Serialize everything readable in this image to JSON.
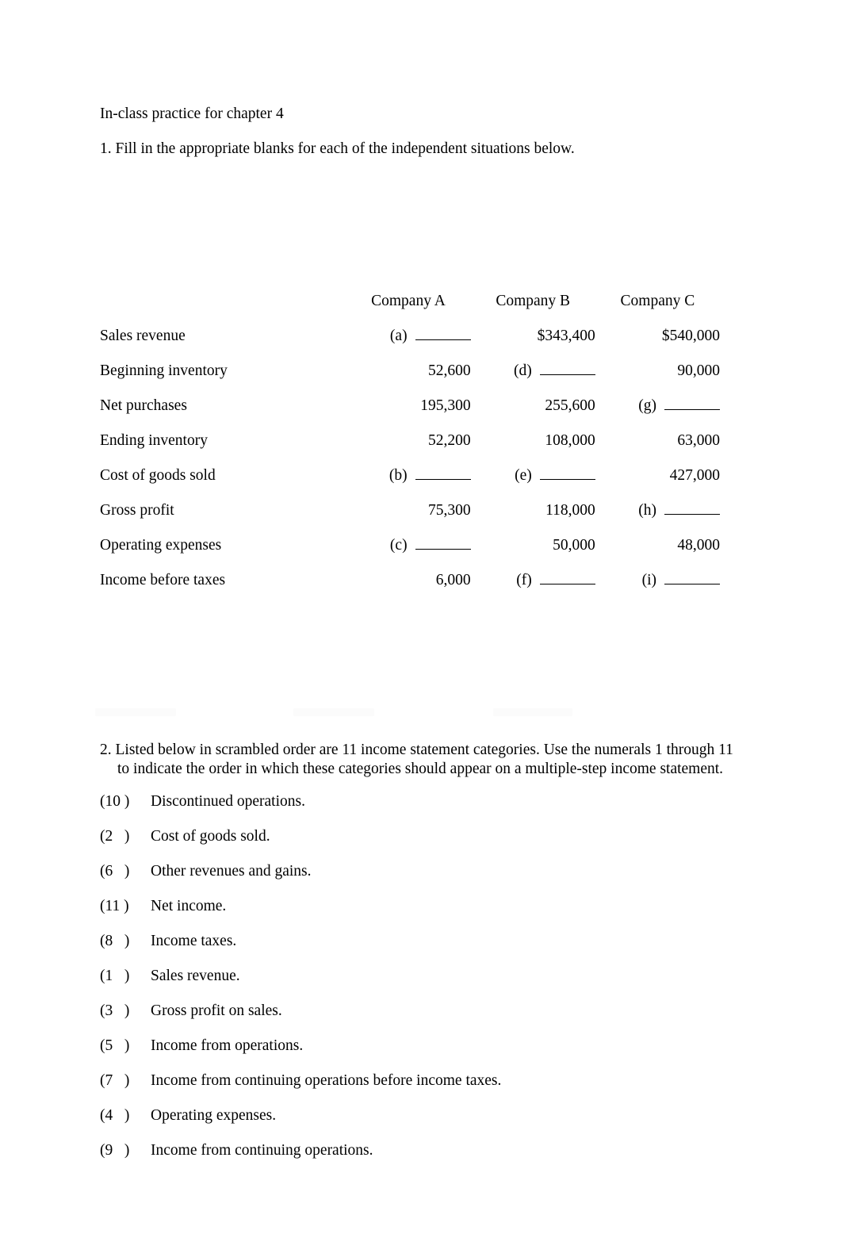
{
  "document": {
    "title": "In-class practice for chapter 4",
    "question1": "1. Fill in the appropriate blanks for each of the independent situations below."
  },
  "table": {
    "row_header_blank": "",
    "columns": [
      "Company A",
      "Company B",
      "Company C"
    ],
    "rows": [
      {
        "label": "Sales revenue",
        "cells": [
          {
            "type": "blank",
            "tag": "(a)",
            "value": ""
          },
          {
            "type": "value",
            "tag": "",
            "value": "$343,400"
          },
          {
            "type": "value",
            "tag": "",
            "value": "$540,000"
          }
        ]
      },
      {
        "label": "Beginning inventory",
        "cells": [
          {
            "type": "value",
            "tag": "",
            "value": "52,600"
          },
          {
            "type": "blank",
            "tag": "(d)",
            "value": ""
          },
          {
            "type": "value",
            "tag": "",
            "value": "90,000"
          }
        ]
      },
      {
        "label": "Net purchases",
        "cells": [
          {
            "type": "value",
            "tag": "",
            "value": "195,300"
          },
          {
            "type": "value",
            "tag": "",
            "value": "255,600"
          },
          {
            "type": "blank",
            "tag": "(g)",
            "value": ""
          }
        ]
      },
      {
        "label": "Ending inventory",
        "cells": [
          {
            "type": "value",
            "tag": "",
            "value": "52,200"
          },
          {
            "type": "value",
            "tag": "",
            "value": "108,000"
          },
          {
            "type": "value",
            "tag": "",
            "value": "63,000"
          }
        ]
      },
      {
        "label": "Cost of goods sold",
        "cells": [
          {
            "type": "blank",
            "tag": "(b)",
            "value": ""
          },
          {
            "type": "blank",
            "tag": "(e)",
            "value": ""
          },
          {
            "type": "value",
            "tag": "",
            "value": "427,000"
          }
        ]
      },
      {
        "label": "Gross profit",
        "cells": [
          {
            "type": "value",
            "tag": "",
            "value": "75,300"
          },
          {
            "type": "value",
            "tag": "",
            "value": "118,000"
          },
          {
            "type": "blank",
            "tag": "(h)",
            "value": ""
          }
        ]
      },
      {
        "label": "Operating expenses",
        "cells": [
          {
            "type": "blank",
            "tag": "(c)",
            "value": ""
          },
          {
            "type": "value",
            "tag": "",
            "value": "50,000"
          },
          {
            "type": "value",
            "tag": "",
            "value": "48,000"
          }
        ]
      },
      {
        "label": "Income before taxes",
        "cells": [
          {
            "type": "value",
            "tag": "",
            "value": "6,000"
          },
          {
            "type": "blank",
            "tag": "(f)",
            "value": ""
          },
          {
            "type": "blank",
            "tag": "(i)",
            "value": ""
          }
        ]
      }
    ]
  },
  "question2": {
    "number": "2.",
    "text": " Listed below in scrambled order are 11 income statement categories. Use the numerals 1 through 11 to",
    "text_line2": "indicate the order in which these categories should appear on a multiple-step income statement.",
    "items": [
      {
        "order": "(10 )",
        "category": "Discontinued operations."
      },
      {
        "order": "(2   )",
        "category": "Cost of goods sold."
      },
      {
        "order": "(6   )",
        "category": "Other revenues and gains."
      },
      {
        "order": "(11 )",
        "category": "Net income."
      },
      {
        "order": "(8   )",
        "category": "Income taxes."
      },
      {
        "order": "(1   )",
        "category": "Sales revenue."
      },
      {
        "order": "(3   )",
        "category": "Gross profit on sales."
      },
      {
        "order": "(5   )",
        "category": "Income from operations."
      },
      {
        "order": "(7   )",
        "category": "Income from continuing operations before income taxes."
      },
      {
        "order": "(4   )",
        "category": "Operating expenses."
      },
      {
        "order": "(9   )",
        "category": "Income from continuing operations."
      }
    ]
  }
}
